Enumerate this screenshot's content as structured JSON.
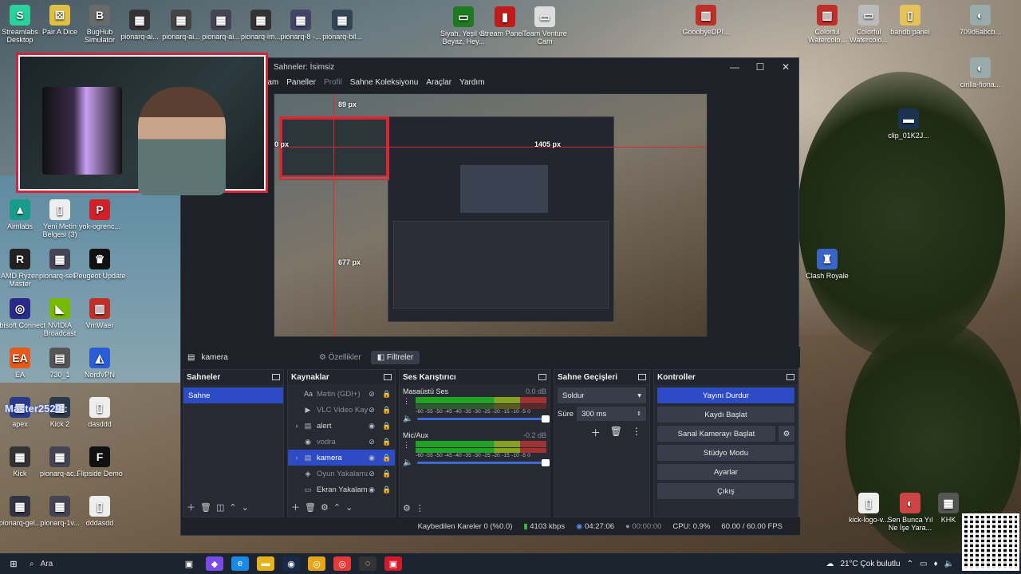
{
  "desktop": {
    "icons": [
      {
        "label": "Streamlabs Desktop",
        "glyph": "S",
        "color": "#2ad19a"
      },
      {
        "label": "Pair A Dice",
        "glyph": "⚄",
        "color": "#e0c040"
      },
      {
        "label": "BugHub Simulator",
        "glyph": "B",
        "color": "#6a6a6a"
      },
      {
        "label": "pionarq-ai...",
        "glyph": "▦",
        "color": "#333"
      },
      {
        "label": "pionarq-ai...",
        "glyph": "▦",
        "color": "#444"
      },
      {
        "label": "pionarq-ai...",
        "glyph": "▦",
        "color": "#445"
      },
      {
        "label": "pionarq-im...",
        "glyph": "▦",
        "color": "#333"
      },
      {
        "label": "pionarq-8 -...",
        "glyph": "▦",
        "color": "#446"
      },
      {
        "label": "pionarq-bil...",
        "glyph": "▦",
        "color": "#345"
      },
      {
        "label": "Siyah, Yeşil ve Beyaz, Hey...",
        "glyph": "▭",
        "color": "#1e7a1e"
      },
      {
        "label": "Stream Panel...",
        "glyph": "▮",
        "color": "#c01a1a"
      },
      {
        "label": "Team Venture Cam",
        "glyph": "▭",
        "color": "#ddd"
      },
      {
        "label": "GoodbyeDPI...",
        "glyph": "▥",
        "color": "#c0302a"
      },
      {
        "label": "Colorful Watercolo...",
        "glyph": "▥",
        "color": "#c0302a"
      },
      {
        "label": "Colorful Watercolo...",
        "glyph": "▭",
        "color": "#bbb"
      },
      {
        "label": "bandb panel",
        "glyph": "▯",
        "color": "#e6c25a"
      },
      {
        "label": "709d6abcb...",
        "glyph": "◐",
        "color": "#9aa"
      },
      {
        "label": "cirilla-fiona...",
        "glyph": "◐",
        "color": "#9aa"
      },
      {
        "label": "clip_01K2J...",
        "glyph": "▬",
        "color": "#1b3350"
      },
      {
        "label": "Clash Royale",
        "glyph": "♜",
        "color": "#3866c8"
      },
      {
        "label": "Aimlabs",
        "glyph": "▲",
        "color": "#1a9a8a"
      },
      {
        "label": "Yeni Metin Belgesi (3)",
        "glyph": "▯",
        "color": "#eee"
      },
      {
        "label": "yok-ogrenc...",
        "glyph": "P",
        "color": "#d0202a"
      },
      {
        "label": "AMD Ryzen Master",
        "glyph": "R",
        "color": "#222"
      },
      {
        "label": "pionarq-sel...",
        "glyph": "▦",
        "color": "#445"
      },
      {
        "label": "Peugeot Update",
        "glyph": "♛",
        "color": "#111"
      },
      {
        "label": "Ubisoft Connect",
        "glyph": "◎",
        "color": "#2a2a8a"
      },
      {
        "label": "NVIDIA Broadcast",
        "glyph": "◣",
        "color": "#76b900"
      },
      {
        "label": "VmWaer",
        "glyph": "▥",
        "color": "#c0302a"
      },
      {
        "label": "EA",
        "glyph": "EA",
        "color": "#e85a1a"
      },
      {
        "label": "730_1",
        "glyph": "▤",
        "color": "#555"
      },
      {
        "label": "NordVPN",
        "glyph": "◭",
        "color": "#2a5cd6"
      },
      {
        "label": "apex",
        "glyph": "▦",
        "color": "#2a3a8a"
      },
      {
        "label": "Kick 2",
        "glyph": "▦",
        "color": "#2a3a4a"
      },
      {
        "label": "dasddd",
        "glyph": "▯",
        "color": "#eee"
      },
      {
        "label": "Kick",
        "glyph": "▦",
        "color": "#333"
      },
      {
        "label": "pionarq-ac...",
        "glyph": "▦",
        "color": "#445"
      },
      {
        "label": "Flipside Demo",
        "glyph": "F",
        "color": "#111"
      },
      {
        "label": "pionarq-gel...",
        "glyph": "▦",
        "color": "#334"
      },
      {
        "label": "pionarq-1v...",
        "glyph": "▦",
        "color": "#445"
      },
      {
        "label": "dddasdd",
        "glyph": "▯",
        "color": "#eee"
      },
      {
        "label": "kick-logo-v...",
        "glyph": "▯",
        "color": "#eee"
      },
      {
        "label": "Sen Bunca Yıl Ne İşe Yara...",
        "glyph": "◐",
        "color": "#c44"
      },
      {
        "label": "KHK",
        "glyph": "▦",
        "color": "#555"
      }
    ],
    "overlay_name": "Master2529 :"
  },
  "obs": {
    "title": "Sahneler: İsimsiz",
    "menu": [
      "...am",
      "Paneller",
      "Profil",
      "Sahne Koleksiyonu",
      "Araçlar",
      "Yardım"
    ],
    "preview_labels": {
      "top": "89 px",
      "right": "1405 px",
      "left_mid": "677 px",
      "left_small": "0 px"
    },
    "source_selected": "kamera",
    "tabs": {
      "properties": "Özellikler",
      "filters": "Filtreler"
    },
    "scenes": {
      "title": "Sahneler",
      "items": [
        "Sahne"
      ]
    },
    "sources": {
      "title": "Kaynaklar",
      "items": [
        {
          "name": "Metin (GDI+)",
          "visible": false,
          "expand": false,
          "icon": "Aa"
        },
        {
          "name": "VLC Video Kayna",
          "visible": false,
          "expand": false,
          "icon": "▶"
        },
        {
          "name": "alert",
          "visible": true,
          "expand": true,
          "icon": "▤"
        },
        {
          "name": "vodra",
          "visible": false,
          "expand": false,
          "icon": "◉"
        },
        {
          "name": "kamera",
          "visible": true,
          "expand": true,
          "icon": "▤",
          "selected": true
        },
        {
          "name": "Oyun Yakalama",
          "visible": false,
          "expand": false,
          "icon": "◈"
        },
        {
          "name": "Ekran Yakalama",
          "visible": true,
          "expand": false,
          "icon": "▭"
        }
      ]
    },
    "mixer": {
      "title": "Ses Karıştırıcı",
      "channels": [
        {
          "name": "Masaüstü Ses",
          "db": "0.0 dB"
        },
        {
          "name": "Mic/Aux",
          "db": "-0.2 dB"
        }
      ],
      "scale": "-60 -55 -50 -45 -40 -35 -30 -25 -20 -15 -10 -5 0"
    },
    "transitions": {
      "title": "Sahne Geçişleri",
      "type": "Soldur",
      "duration_label": "Süre",
      "duration": "300 ms"
    },
    "controls": {
      "title": "Kontroller",
      "buttons": [
        "Yayını Durdur",
        "Kaydı Başlat",
        "Sanal Kamerayı Başlat",
        "Stüdyo Modu",
        "Ayarlar",
        "Çıkış"
      ]
    },
    "status": {
      "dropped": "Kaybedilen Kareler 0 (%0.0)",
      "bitrate": "4103 kbps",
      "live_time": "04:27:06",
      "rec_time": "00:00:00",
      "cpu": "CPU: 0.9%",
      "fps": "60.00 / 60.00 FPS"
    }
  },
  "taskbar": {
    "search": "Ara",
    "weather": "21°C  Çok bulutlu"
  }
}
